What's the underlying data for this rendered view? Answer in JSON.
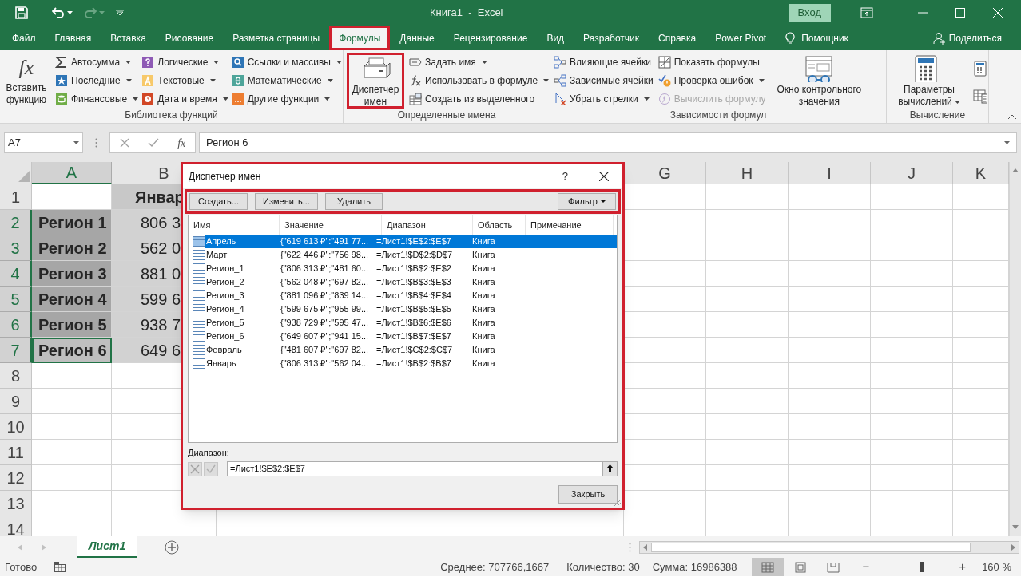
{
  "title_bar": {
    "title": "Книга1  -  Excel",
    "sign_in": "Вход"
  },
  "ribbon_tabs": [
    {
      "label": "Файл",
      "selected": false,
      "highlighted": false
    },
    {
      "label": "Главная",
      "selected": false,
      "highlighted": false
    },
    {
      "label": "Вставка",
      "selected": false,
      "highlighted": false
    },
    {
      "label": "Рисование",
      "selected": false,
      "highlighted": false
    },
    {
      "label": "Разметка страницы",
      "selected": false,
      "highlighted": false
    },
    {
      "label": "Формулы",
      "selected": true,
      "highlighted": true
    },
    {
      "label": "Данные",
      "selected": false,
      "highlighted": false
    },
    {
      "label": "Рецензирование",
      "selected": false,
      "highlighted": false
    },
    {
      "label": "Вид",
      "selected": false,
      "highlighted": false
    },
    {
      "label": "Разработчик",
      "selected": false,
      "highlighted": false
    },
    {
      "label": "Справка",
      "selected": false,
      "highlighted": false
    },
    {
      "label": "Power Pivot",
      "selected": false,
      "highlighted": false
    }
  ],
  "tell_me": "Помощник",
  "share": "Поделиться",
  "ribbon_groups": [
    {
      "label": "Библиотека функций",
      "items": [
        {
          "kind": "large",
          "label": "Вставить функцию",
          "glyph": "fx",
          "dropdown": false,
          "highlighted": false
        },
        {
          "kind": "small",
          "label": "Автосумма",
          "dropdown": true,
          "disabled": false
        },
        {
          "kind": "small",
          "label": "Последние",
          "dropdown": true,
          "disabled": false
        },
        {
          "kind": "small",
          "label": "Финансовые",
          "dropdown": true,
          "disabled": false
        },
        {
          "kind": "small",
          "label": "Логические",
          "dropdown": true,
          "disabled": false
        },
        {
          "kind": "small",
          "label": "Текстовые",
          "dropdown": true,
          "disabled": false
        },
        {
          "kind": "small",
          "label": "Дата и время",
          "dropdown": true,
          "disabled": false
        },
        {
          "kind": "small",
          "label": "Ссылки и массивы",
          "dropdown": true,
          "disabled": false
        },
        {
          "kind": "small",
          "label": "Математические",
          "dropdown": true,
          "disabled": false
        },
        {
          "kind": "small",
          "label": "Другие функции",
          "dropdown": true,
          "disabled": false
        }
      ]
    },
    {
      "label": "Определенные имена",
      "items": [
        {
          "kind": "large",
          "label": "Диспетчер имен",
          "dropdown": false,
          "highlighted": true
        },
        {
          "kind": "small",
          "label": "Задать имя",
          "dropdown": true,
          "disabled": false
        },
        {
          "kind": "small",
          "label": "Использовать в формуле",
          "dropdown": true,
          "disabled": false
        },
        {
          "kind": "small",
          "label": "Создать из выделенного",
          "dropdown": false,
          "disabled": false
        }
      ]
    },
    {
      "label": "Зависимости формул",
      "items": [
        {
          "kind": "small",
          "label": "Влияющие ячейки",
          "dropdown": false,
          "disabled": false
        },
        {
          "kind": "small",
          "label": "Зависимые ячейки",
          "dropdown": false,
          "disabled": false
        },
        {
          "kind": "small",
          "label": "Убрать стрелки",
          "dropdown": true,
          "disabled": false
        },
        {
          "kind": "small",
          "label": "Показать формулы",
          "dropdown": false,
          "disabled": false
        },
        {
          "kind": "small",
          "label": "Проверка ошибок",
          "dropdown": true,
          "disabled": false
        },
        {
          "kind": "small",
          "label": "Вычислить формулу",
          "dropdown": false,
          "disabled": true
        },
        {
          "kind": "large",
          "label": "Окно контрольного значения",
          "dropdown": false,
          "highlighted": false
        }
      ]
    },
    {
      "label": "Вычисление",
      "items": [
        {
          "kind": "large",
          "label": "Параметры вычислений",
          "dropdown": true,
          "highlighted": false
        },
        {
          "kind": "icon"
        },
        {
          "kind": "icon"
        }
      ]
    }
  ],
  "formula_bar": {
    "name_box": "A7",
    "fx": "fx",
    "formula": "Регион 6"
  },
  "columns": [
    {
      "label": "A",
      "selected": true
    },
    {
      "label": "B",
      "selected": false
    },
    {
      "label": "G",
      "selected": false
    },
    {
      "label": "H",
      "selected": false
    },
    {
      "label": "I",
      "selected": false
    },
    {
      "label": "J",
      "selected": false
    },
    {
      "label": "K",
      "selected": false
    }
  ],
  "rows": [
    {
      "label": "1",
      "selected": false,
      "active": false,
      "B": "Январ"
    },
    {
      "label": "2",
      "selected": true,
      "active": false,
      "A": "Регион 1",
      "B": "806 3"
    },
    {
      "label": "3",
      "selected": true,
      "active": false,
      "A": "Регион 2",
      "B": "562 0"
    },
    {
      "label": "4",
      "selected": true,
      "active": false,
      "A": "Регион 3",
      "B": "881 0"
    },
    {
      "label": "5",
      "selected": true,
      "active": false,
      "A": "Регион 4",
      "B": "599 6"
    },
    {
      "label": "6",
      "selected": true,
      "active": false,
      "A": "Регион 5",
      "B": "938 7"
    },
    {
      "label": "7",
      "selected": true,
      "active": true,
      "A": "Регион 6",
      "B": "649 6"
    },
    {
      "label": "8",
      "selected": false,
      "active": false
    },
    {
      "label": "9",
      "selected": false,
      "active": false
    },
    {
      "label": "10",
      "selected": false,
      "active": false
    },
    {
      "label": "11",
      "selected": false,
      "active": false
    },
    {
      "label": "12",
      "selected": false,
      "active": false
    },
    {
      "label": "13",
      "selected": false,
      "active": false
    },
    {
      "label": "14",
      "selected": false,
      "active": false
    }
  ],
  "dialog": {
    "title": "Диспетчер имен",
    "help": "?",
    "highlighted": true,
    "toolbar": {
      "highlighted": true,
      "buttons": [
        "Создать...",
        "Изменить...",
        "Удалить"
      ],
      "filter": "Фильтр"
    },
    "columns": [
      "Имя",
      "Значение",
      "Диапазон",
      "Область",
      "Примечание"
    ],
    "rows": [
      {
        "name": "Апрель",
        "value": "{\"619 613 ₽\":\"491 77...",
        "range": "=Лист1!$E$2:$E$7",
        "scope": "Книга",
        "selected": true
      },
      {
        "name": "Март",
        "value": "{\"622 446 ₽\":\"756 98...",
        "range": "=Лист1!$D$2:$D$7",
        "scope": "Книга",
        "selected": false
      },
      {
        "name": "Регион_1",
        "value": "{\"806 313 ₽\";\"481 60...",
        "range": "=Лист1!$B$2:$E$2",
        "scope": "Книга",
        "selected": false
      },
      {
        "name": "Регион_2",
        "value": "{\"562 048 ₽\";\"697 82...",
        "range": "=Лист1!$B$3:$E$3",
        "scope": "Книга",
        "selected": false
      },
      {
        "name": "Регион_3",
        "value": "{\"881 096 ₽\";\"839 14...",
        "range": "=Лист1!$B$4:$E$4",
        "scope": "Книга",
        "selected": false
      },
      {
        "name": "Регион_4",
        "value": "{\"599 675 ₽\";\"955 99...",
        "range": "=Лист1!$B$5:$E$5",
        "scope": "Книга",
        "selected": false
      },
      {
        "name": "Регион_5",
        "value": "{\"938 729 ₽\";\"595 47...",
        "range": "=Лист1!$B$6:$E$6",
        "scope": "Книга",
        "selected": false
      },
      {
        "name": "Регион_6",
        "value": "{\"649 607 ₽\";\"941 15...",
        "range": "=Лист1!$B$7:$E$7",
        "scope": "Книга",
        "selected": false
      },
      {
        "name": "Февраль",
        "value": "{\"481 607 ₽\":\"697 82...",
        "range": "=Лист1!$C$2:$C$7",
        "scope": "Книга",
        "selected": false
      },
      {
        "name": "Январь",
        "value": "{\"806 313 ₽\":\"562 04...",
        "range": "=Лист1!$B$2:$B$7",
        "scope": "Книга",
        "selected": false
      }
    ],
    "range_label": "Диапазон:",
    "range_value": "=Лист1!$E$2:$E$7",
    "close": "Закрыть"
  },
  "sheet_tabs": [
    {
      "label": "Лист1",
      "selected": true
    }
  ],
  "status_bar": {
    "ready": "Готово",
    "average": "Среднее: 707766,1667",
    "count": "Количество: 30",
    "sum": "Сумма: 16986388",
    "views": [
      {
        "selected": true
      },
      {
        "selected": false
      },
      {
        "selected": false
      }
    ],
    "zoom": {
      "minus": "−",
      "plus": "+",
      "level": 0.59,
      "label": "160 %"
    }
  }
}
